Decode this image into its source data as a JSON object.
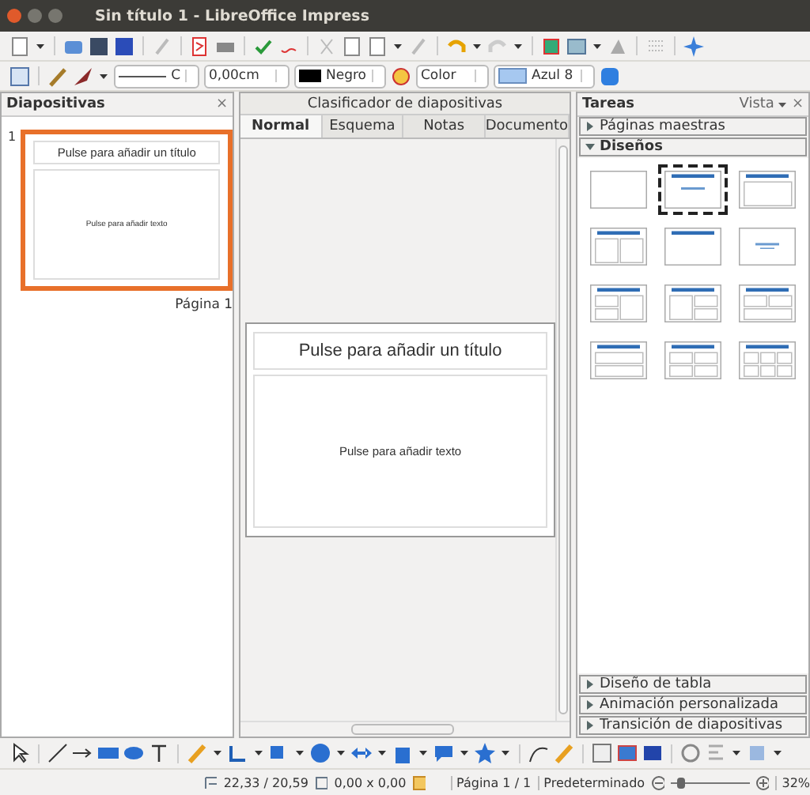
{
  "window": {
    "title": "Sin título 1 - LibreOffice Impress"
  },
  "line_bar": {
    "line_width": "C",
    "offset": "0,00cm",
    "line_color": {
      "name": "Negro",
      "color": "#000000"
    },
    "fill_type": "Color",
    "fill_color": {
      "name": "Azul 8",
      "color": "#a6c8f0"
    }
  },
  "slides_panel": {
    "title": "Diapositivas",
    "close": "×",
    "slides": [
      {
        "number": "1",
        "title": "Pulse para añadir un título",
        "body": "Pulse para añadir texto",
        "caption": "Página 1",
        "selected": true
      }
    ]
  },
  "center": {
    "header": "Clasificador de diapositivas",
    "tabs": [
      {
        "label": "Normal",
        "selected": true
      },
      {
        "label": "Esquema",
        "selected": false
      },
      {
        "label": "Notas",
        "selected": false
      },
      {
        "label": "Documento",
        "selected": false
      }
    ],
    "slide": {
      "title": "Pulse para añadir un título",
      "body": "Pulse para añadir texto"
    }
  },
  "tasks_panel": {
    "title": "Tareas",
    "view": "Vista",
    "close": "×",
    "sections_top": [
      {
        "label": "Páginas maestras",
        "expanded": false
      },
      {
        "label": "Diseños",
        "expanded": true
      }
    ],
    "layouts": [
      {
        "kind": "blank",
        "selected": false
      },
      {
        "kind": "title-subtitle",
        "selected": true
      },
      {
        "kind": "title-content",
        "selected": false
      },
      {
        "kind": "title-2col",
        "selected": false
      },
      {
        "kind": "title-only",
        "selected": false
      },
      {
        "kind": "centered",
        "selected": false
      },
      {
        "kind": "title-2left-right",
        "selected": false
      },
      {
        "kind": "title-left-2right",
        "selected": false
      },
      {
        "kind": "title-2top-bottom",
        "selected": false
      },
      {
        "kind": "title-top-bottom",
        "selected": false
      },
      {
        "kind": "title-2x2",
        "selected": false
      },
      {
        "kind": "title-3x2",
        "selected": false
      }
    ],
    "sections_bottom": [
      {
        "label": "Diseño de tabla",
        "expanded": false
      },
      {
        "label": "Animación personalizada",
        "expanded": false
      },
      {
        "label": "Transición de diapositivas",
        "expanded": false
      }
    ]
  },
  "status_bar": {
    "position": "22,33 / 20,59",
    "size": "0,00 x 0,00",
    "page": "Página 1 / 1",
    "master": "Predeterminado",
    "zoom": {
      "level": 0.12
    },
    "zoom_value": "32%"
  }
}
